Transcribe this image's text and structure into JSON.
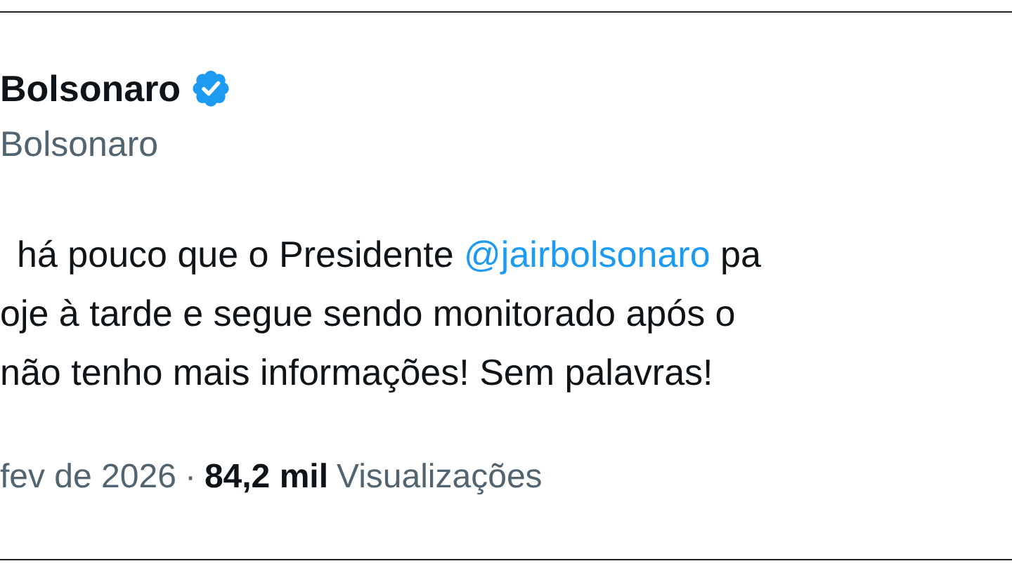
{
  "author": {
    "name": "Bolsonaro",
    "verified": true,
    "handle": "Bolsonaro"
  },
  "body": {
    "lines": [
      {
        "before": "há pouco que o Presidente ",
        "mention": "@jairbolsonaro",
        "after": " pa"
      },
      {
        "before": "oje à tarde e segue sendo monitorado após o"
      },
      {
        "before": "não tenho mais informações! Sem palavras!"
      }
    ]
  },
  "meta": {
    "date": "fev de 2026",
    "separator": "·",
    "views_count": "84,2 mil",
    "views_label": "Visualizações"
  }
}
